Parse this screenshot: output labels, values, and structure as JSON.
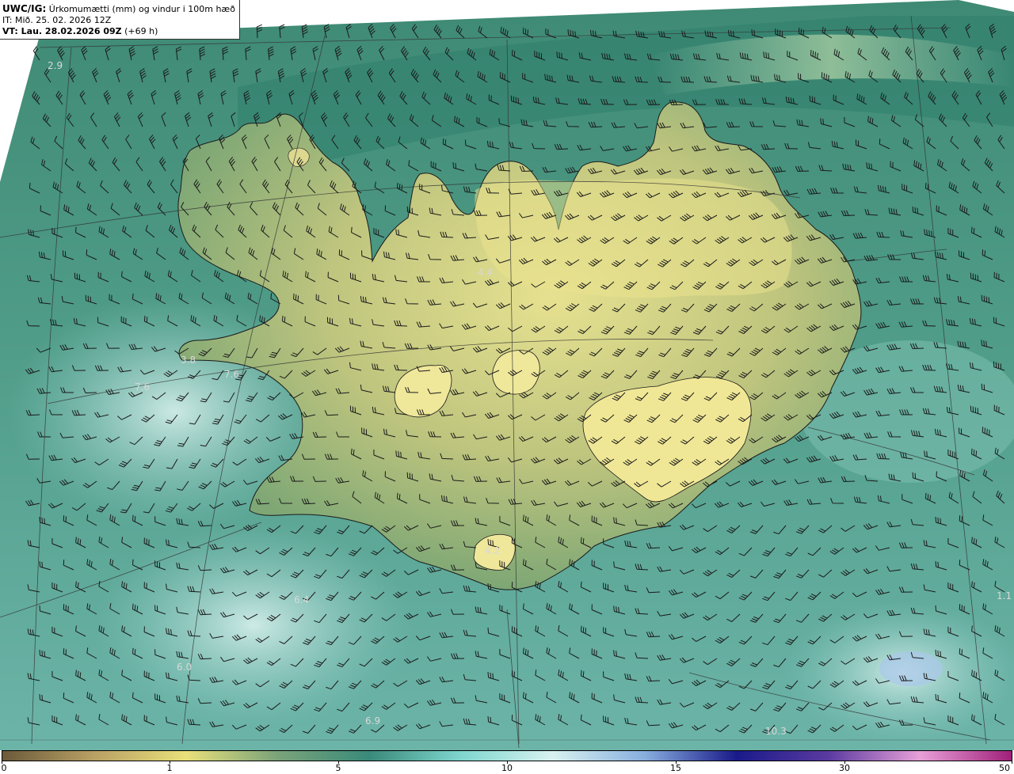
{
  "header": {
    "model": "UWC/IG:",
    "title": "Úrkomumætti (mm) og vindur i 100m hæð",
    "it_line": "IT: Mið. 25. 02. 2026 12Z",
    "vt_prefix": "VT: Lau. 28.02.2026 09Z",
    "vt_suffix": "(+69 h)"
  },
  "colorbar": {
    "labels": [
      "0",
      "1",
      "5",
      "10",
      "15",
      "30",
      "50"
    ],
    "stops": [
      "#6b5a3a",
      "#b9a064",
      "#e8e07a",
      "#7aa37a",
      "#3a8a7a",
      "#7fd6cf",
      "#d8f2f0",
      "#88aede",
      "#1a1a8a",
      "#5a3aa0",
      "#e8a0d8",
      "#a0207a"
    ]
  },
  "map": {
    "colors": {
      "ocean_dark": "#2f7f6e",
      "ocean_mid": "#4a9a88",
      "ocean_light": "#8fcbc4",
      "land_low": "#5f9970",
      "land_mid": "#a6b97a",
      "land_high": "#e2de8c",
      "coast": "#1a1a1a",
      "grid": "#333333",
      "barb": "#1a1a1a"
    },
    "precip_labels": [
      "2.9",
      "4.4",
      "3.8",
      "7.6",
      "7.6",
      "6.4",
      "6.0",
      "6.9",
      "10.3",
      "1.1",
      "4.2"
    ]
  }
}
